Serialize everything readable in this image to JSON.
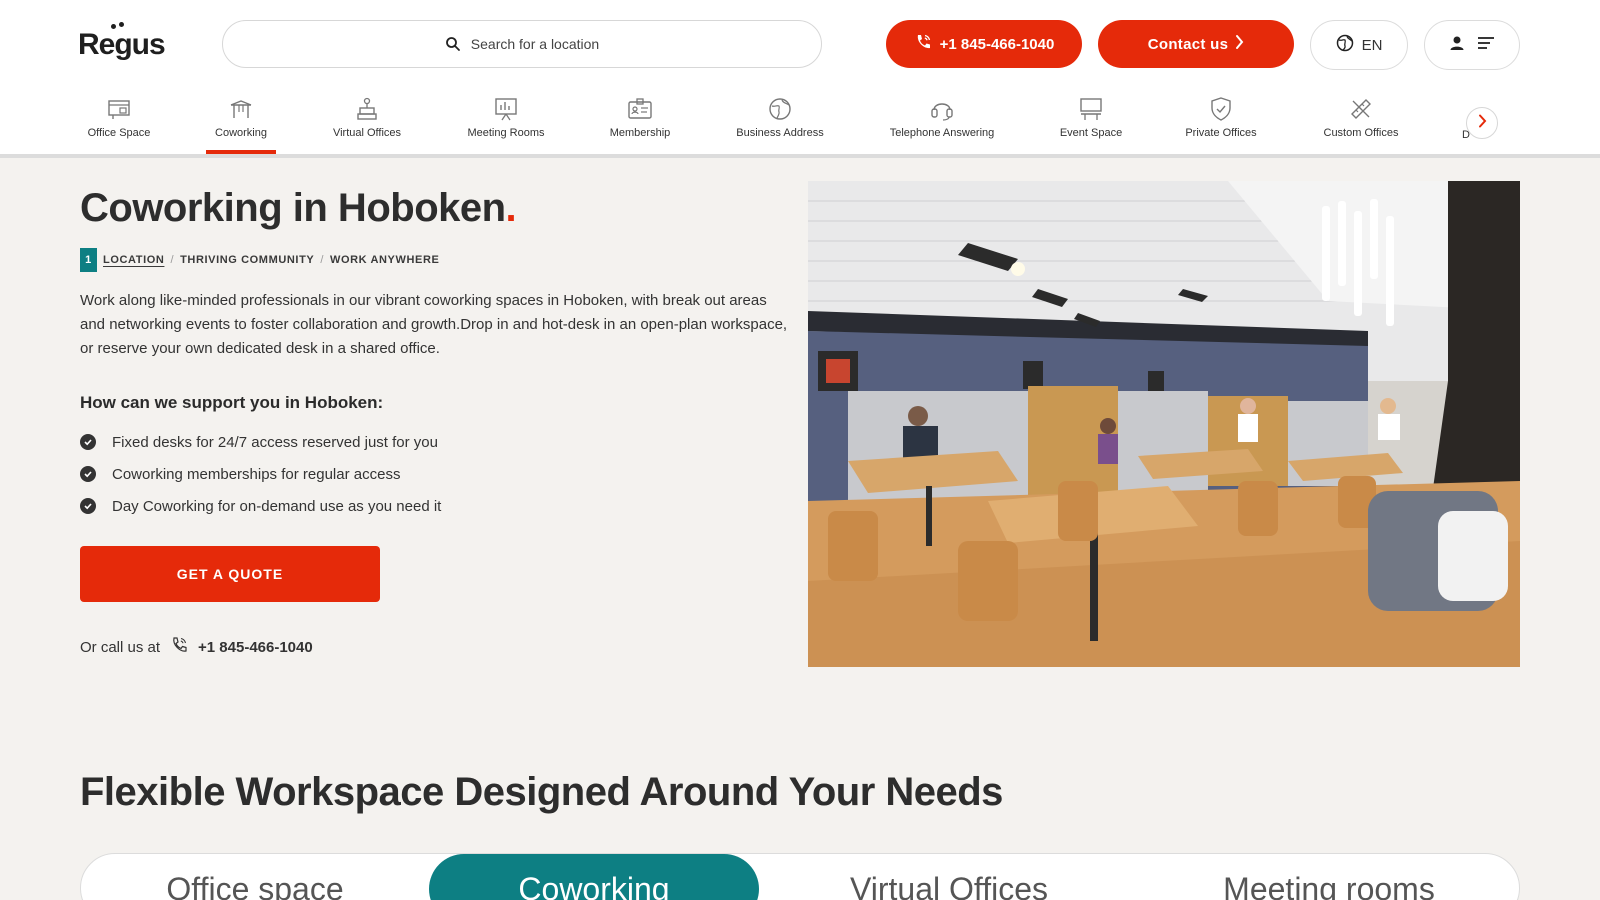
{
  "header": {
    "logo": "Regus",
    "search_placeholder": "Search for a location",
    "phone_label": "+1 845-466-1040",
    "contact_label": "Contact us",
    "language": "EN"
  },
  "nav": {
    "items": [
      {
        "label": "Office Space",
        "icon": "office-space-icon"
      },
      {
        "label": "Coworking",
        "icon": "coworking-icon",
        "active": true
      },
      {
        "label": "Virtual Offices",
        "icon": "virtual-offices-icon"
      },
      {
        "label": "Meeting Rooms",
        "icon": "meeting-rooms-icon"
      },
      {
        "label": "Membership",
        "icon": "membership-icon"
      },
      {
        "label": "Business Address",
        "icon": "business-address-icon"
      },
      {
        "label": "Telephone Answering",
        "icon": "telephone-answering-icon"
      },
      {
        "label": "Event Space",
        "icon": "event-space-icon"
      },
      {
        "label": "Private Offices",
        "icon": "private-offices-icon"
      },
      {
        "label": "Custom Offices",
        "icon": "custom-offices-icon"
      }
    ],
    "truncated_label": "D"
  },
  "hero": {
    "title": "Coworking in Hoboken",
    "title_dot": ".",
    "location_count": "1",
    "crumbs": [
      "LOCATION",
      "THRIVING COMMUNITY",
      "WORK ANYWHERE"
    ],
    "description": "Work along like-minded professionals in our vibrant coworking spaces in Hoboken, with break out areas and networking events to foster collaboration and growth.Drop in and hot-desk in an open-plan workspace, or reserve your own dedicated desk in a shared office.",
    "support_title": "How can we support you in Hoboken:",
    "benefits": [
      "Fixed desks for 24/7 access reserved just for you",
      "Coworking memberships for regular access",
      "Day Coworking for on-demand use as you need it"
    ],
    "cta": "GET A QUOTE",
    "call_prefix": "Or call us at",
    "call_number": "+1 845-466-1040"
  },
  "section": {
    "title": "Flexible Workspace Designed Around Your Needs",
    "tabs": [
      "Office space",
      "Coworking",
      "Virtual Offices",
      "Meeting rooms"
    ],
    "active_tab": "Coworking"
  },
  "colors": {
    "brand_red": "#e52a0a",
    "accent_teal": "#0d7f83",
    "background": "#f4f2ef"
  }
}
